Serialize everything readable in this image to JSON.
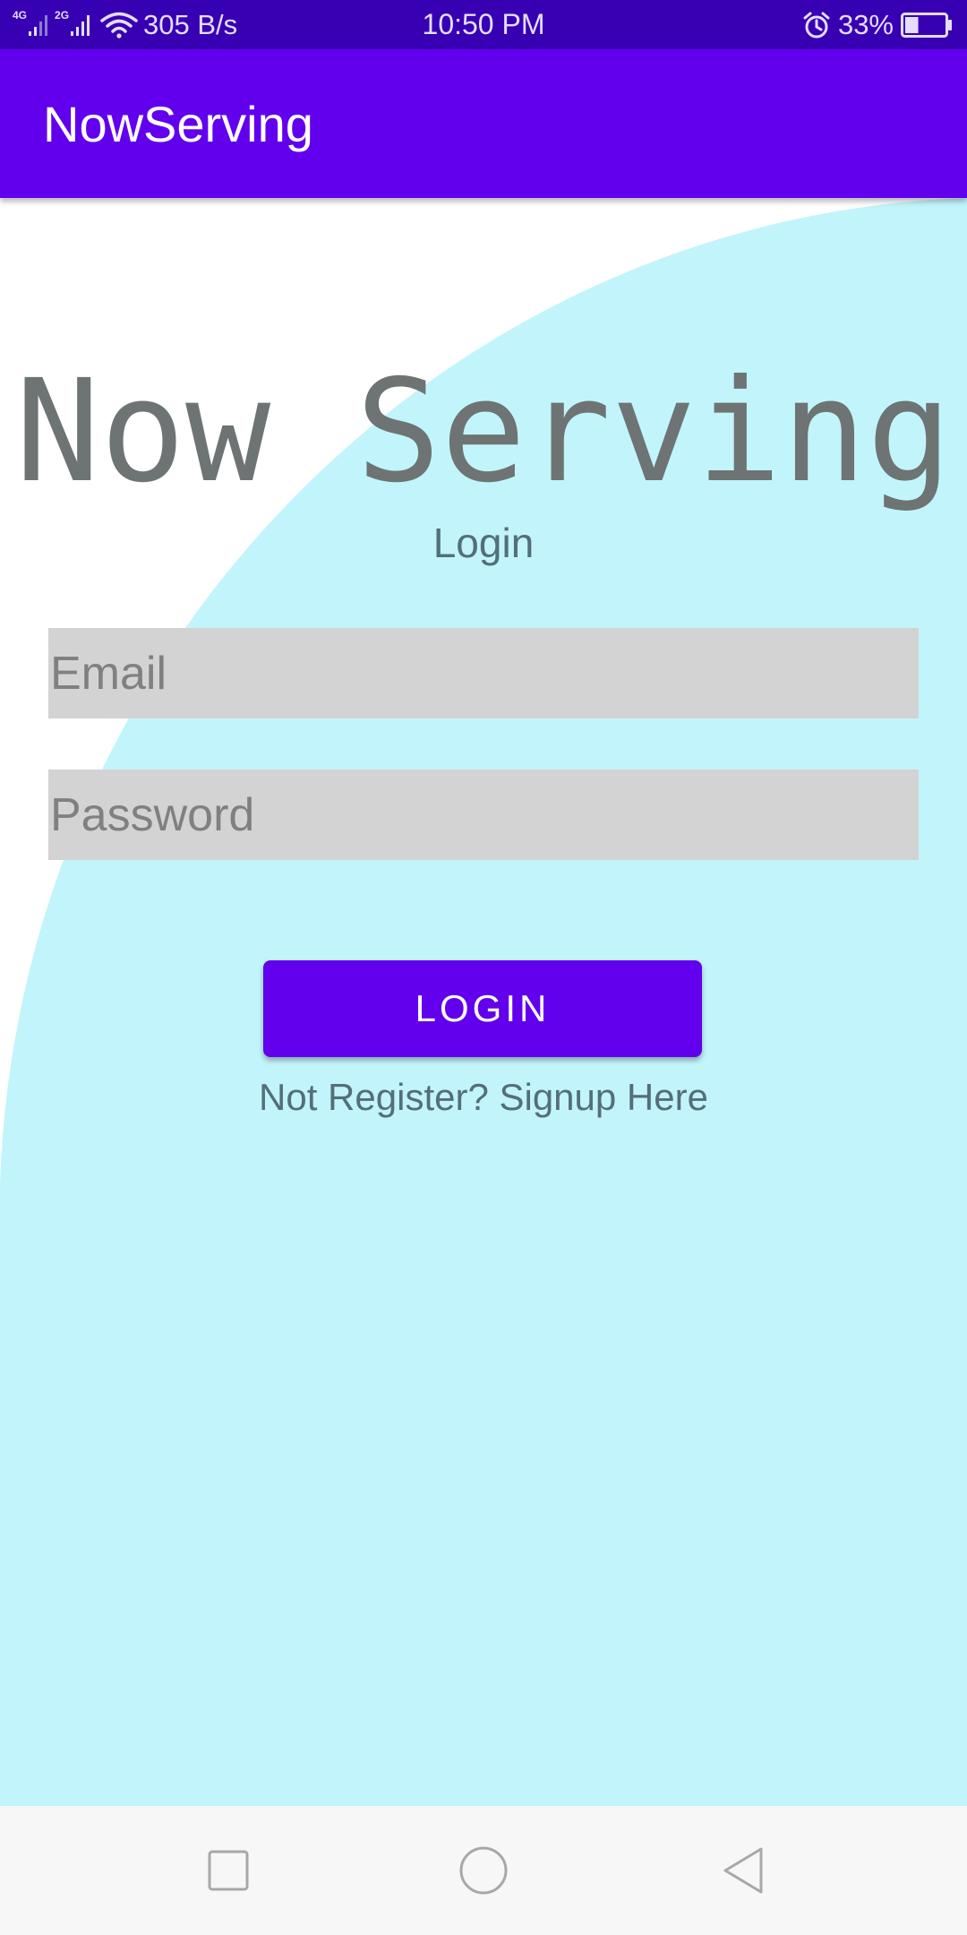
{
  "status_bar": {
    "network_1": "4G",
    "network_2": "2G",
    "speed": "305 B/s",
    "time": "10:50 PM",
    "battery": "33%",
    "battery_level": 0.33,
    "icons": [
      "signal-icon",
      "wifi-icon",
      "alarm-icon",
      "battery-icon"
    ]
  },
  "app_bar": {
    "title": "NowServing"
  },
  "login": {
    "brand_title": "Now Serving",
    "heading": "Login",
    "email_placeholder": "Email",
    "email_value": "",
    "password_placeholder": "Password",
    "password_value": "",
    "login_button": "LOGIN",
    "signup_text": "Not Register? Signup Here"
  },
  "nav_bar": {
    "icons": [
      "recents-icon",
      "home-icon",
      "back-icon"
    ]
  },
  "colors": {
    "status_bar": "#3700b3",
    "primary": "#6200ee",
    "background_shape": "#c1f5fb",
    "input_background": "#d3d3d3",
    "secondary_text": "#546e7a",
    "nav_bar": "#f7f7f7"
  }
}
